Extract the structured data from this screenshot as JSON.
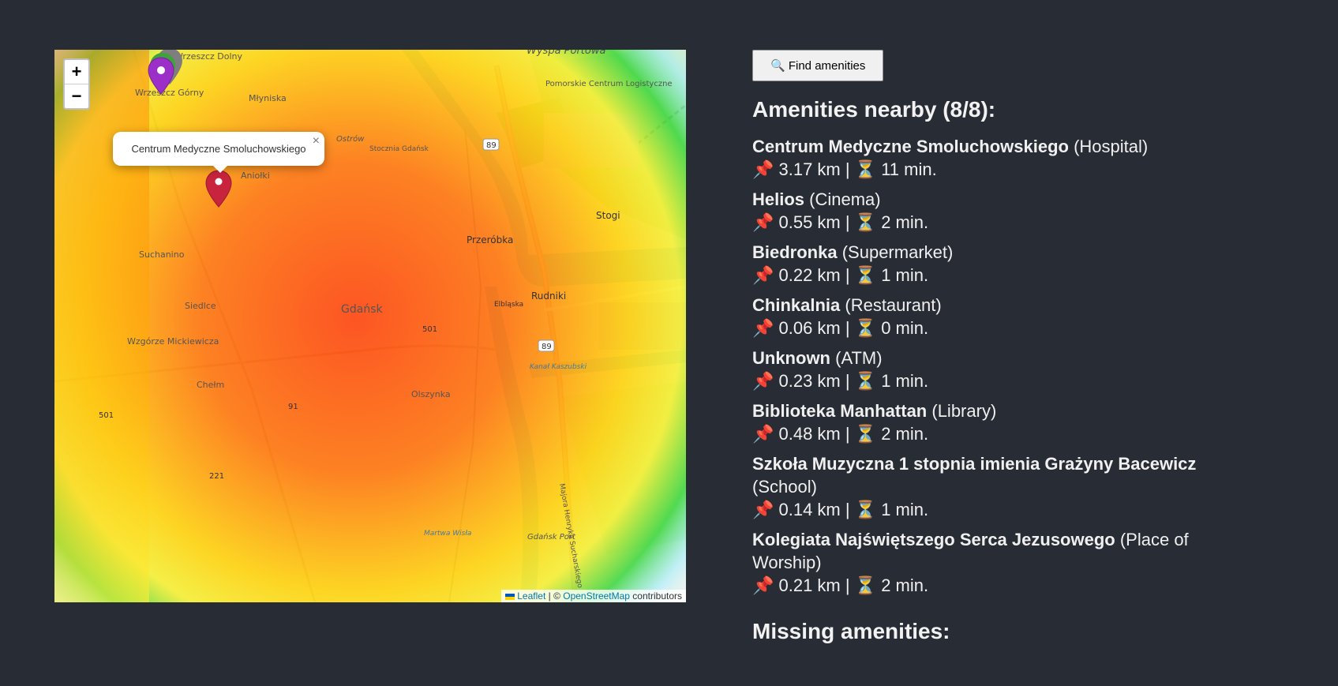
{
  "map": {
    "zoom_in": "+",
    "zoom_out": "−",
    "popup_text": "Centrum Medyczne Smoluchowskiego",
    "popup_close": "×",
    "attribution": {
      "leaflet": "Leaflet",
      "separator": " | © ",
      "osm": "OpenStreetMap",
      "suffix": " contributors"
    },
    "places": [
      "Wyspa Portowa",
      "Pomorskie Centrum Logistyczne",
      "Wrzeszcz Dolny",
      "Wrzeszcz Górny",
      "Młyniska",
      "Ostrów",
      "Stocznia Gdańsk",
      "Aniołki",
      "Stogi",
      "Przeróbka",
      "Suchanino",
      "Siedlce",
      "Gdańsk",
      "Rudniki",
      "Elbląska",
      "Wzgórze Mickiewicza",
      "Chełm",
      "Olszynka",
      "Gdańsk Port",
      "Martwa Wisła",
      "Kanał Kaszubski",
      "Majora Henryka Sucharskiego"
    ],
    "road_numbers": [
      "89",
      "89",
      "501",
      "501",
      "221",
      "91"
    ],
    "colors": {
      "heat_red": "#ff3a00",
      "heat_orange": "#ff8a00",
      "heat_yellow": "#ffe600",
      "heat_green": "#39d63a",
      "heat_cyan": "#9ff0ff",
      "marker_red": "#c8243d",
      "marker_purple": "#9b2fc7",
      "marker_green": "#3fa33a",
      "marker_grey": "#7e7e7e"
    }
  },
  "panel": {
    "find_button": "🔍 Find amenities",
    "heading": "Amenities nearby (8/8):",
    "items": [
      {
        "name": "Centrum Medyczne Smoluchowskiego",
        "type": "(Hospital)",
        "meta": "📌 3.17 km | ⏳ 11 min."
      },
      {
        "name": "Helios",
        "type": "(Cinema)",
        "meta": "📌 0.55 km | ⏳ 2 min."
      },
      {
        "name": "Biedronka",
        "type": "(Supermarket)",
        "meta": "📌 0.22 km | ⏳ 1 min."
      },
      {
        "name": "Chinkalnia",
        "type": "(Restaurant)",
        "meta": "📌 0.06 km | ⏳ 0 min."
      },
      {
        "name": "Unknown",
        "type": "(ATM)",
        "meta": "📌 0.23 km | ⏳ 1 min."
      },
      {
        "name": "Biblioteka Manhattan",
        "type": "(Library)",
        "meta": "📌 0.48 km | ⏳ 2 min."
      },
      {
        "name": "Szkoła Muzyczna 1 stopnia imienia Grażyny Bacewicz",
        "type": "(School)",
        "meta": "📌 0.14 km | ⏳ 1 min."
      },
      {
        "name": "Kolegiata Najświętszego Serca Jezusowego",
        "type": "(Place of Worship)",
        "meta": "📌 0.21 km | ⏳ 2 min."
      }
    ],
    "missing_heading": "Missing amenities:"
  }
}
